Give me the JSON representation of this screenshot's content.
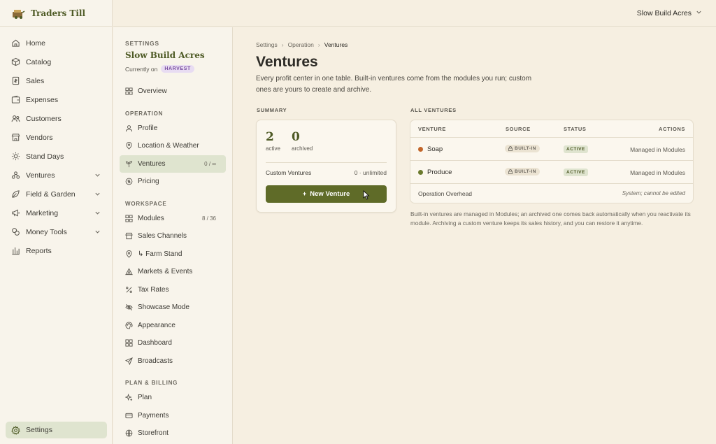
{
  "app": {
    "name": "Traders Till",
    "account": "Slow Build Acres"
  },
  "nav": {
    "items": [
      {
        "label": "Home",
        "icon": "home-icon",
        "chevron": false
      },
      {
        "label": "Catalog",
        "icon": "box-icon",
        "chevron": false
      },
      {
        "label": "Sales",
        "icon": "receipt-icon",
        "chevron": false
      },
      {
        "label": "Expenses",
        "icon": "wallet-icon",
        "chevron": false
      },
      {
        "label": "Customers",
        "icon": "users-icon",
        "chevron": false
      },
      {
        "label": "Vendors",
        "icon": "store-icon",
        "chevron": false
      },
      {
        "label": "Stand Days",
        "icon": "sun-icon",
        "chevron": false
      },
      {
        "label": "Ventures",
        "icon": "network-icon",
        "chevron": true
      },
      {
        "label": "Field & Garden",
        "icon": "leaf-icon",
        "chevron": true
      },
      {
        "label": "Marketing",
        "icon": "megaphone-icon",
        "chevron": true
      },
      {
        "label": "Money Tools",
        "icon": "coins-icon",
        "chevron": true
      },
      {
        "label": "Reports",
        "icon": "bar-chart-icon",
        "chevron": false
      }
    ],
    "settings": "Settings"
  },
  "settings_nav": {
    "caption": "SETTINGS",
    "title": "Slow Build Acres",
    "currently_on": "Currently on",
    "plan_badge": "HARVEST",
    "overview": "Overview",
    "sections": {
      "operation": "OPERATION",
      "workspace": "WORKSPACE",
      "billing": "PLAN & BILLING"
    },
    "operation_items": [
      {
        "label": "Profile",
        "count": ""
      },
      {
        "label": "Location & Weather",
        "count": ""
      },
      {
        "label": "Ventures",
        "count": "0 / ∞"
      },
      {
        "label": "Pricing",
        "count": ""
      }
    ],
    "workspace_items": [
      {
        "label": "Modules",
        "count": "8 / 36"
      },
      {
        "label": "Sales Channels",
        "count": ""
      },
      {
        "label": "↳ Farm Stand",
        "count": ""
      },
      {
        "label": "Markets & Events",
        "count": ""
      },
      {
        "label": "Tax Rates",
        "count": ""
      },
      {
        "label": "Showcase Mode",
        "count": ""
      },
      {
        "label": "Appearance",
        "count": ""
      },
      {
        "label": "Dashboard",
        "count": ""
      },
      {
        "label": "Broadcasts",
        "count": ""
      }
    ],
    "billing_items": [
      {
        "label": "Plan"
      },
      {
        "label": "Payments"
      },
      {
        "label": "Storefront"
      }
    ]
  },
  "main": {
    "breadcrumb": [
      "Settings",
      "Operation",
      "Ventures"
    ],
    "title": "Ventures",
    "description": "Every profit center in one table. Built-in ventures come from the modules you run; custom ones are yours to create and archive.",
    "summary_caption": "SUMMARY",
    "all_caption": "ALL VENTURES",
    "summary": {
      "active_count": "2",
      "active_label": "active",
      "archived_count": "0",
      "archived_label": "archived",
      "custom_label": "Custom Ventures",
      "custom_value": "0 · unlimited",
      "new_button": "New Venture"
    },
    "table": {
      "headers": [
        "VENTURE",
        "SOURCE",
        "STATUS",
        "ACTIONS"
      ],
      "rows": [
        {
          "name": "Soap",
          "dot_color": "#c2662a",
          "source": "BUILT-IN",
          "status": "ACTIVE",
          "action": "Managed in Modules"
        },
        {
          "name": "Produce",
          "dot_color": "#6b7a2e",
          "source": "BUILT-IN",
          "status": "ACTIVE",
          "action": "Managed in Modules"
        }
      ],
      "overhead": {
        "name": "Operation Overhead",
        "note": "System; cannot be edited"
      },
      "footnote": "Built-in ventures are managed in Modules; an archived one comes back automatically when you reactivate its module. Archiving a custom venture keeps its sales history, and you can restore it anytime."
    }
  },
  "colors": {
    "accent": "#5f6b28",
    "bg": "#f6efe1",
    "sidebar": "#f8f4eb"
  }
}
